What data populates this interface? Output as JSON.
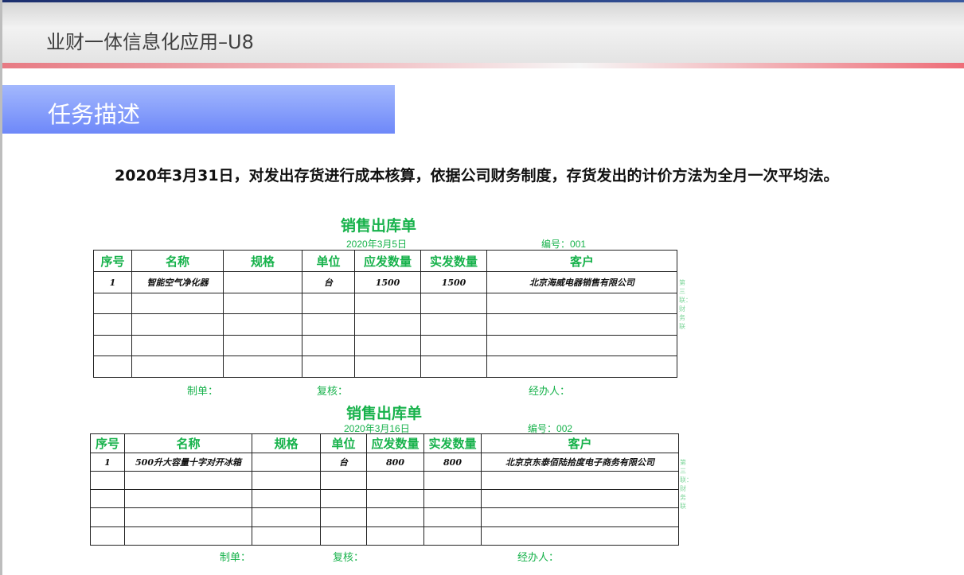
{
  "header": {
    "title": "业财一体信息化应用–U8"
  },
  "section": {
    "title": "任务描述"
  },
  "task": "2020年3月31日，对发出存货进行成本核算，依据公司财务制度，存货发出的计价方法为全月一次平均法。",
  "colors": {
    "green": "#17b24b",
    "section": "#7f97fa"
  },
  "forms": [
    {
      "title": "销售出库单",
      "date": "2020年3月5日",
      "number_label": "编号：",
      "number": "001",
      "columns": [
        "序号",
        "名称",
        "规格",
        "单位",
        "应发数量",
        "实发数量",
        "客户"
      ],
      "rows": [
        [
          "1",
          "智能空气净化器",
          "",
          "台",
          "1500",
          "1500",
          "北京海威电器销售有限公司"
        ],
        [
          "",
          "",
          "",
          "",
          "",
          "",
          ""
        ],
        [
          "",
          "",
          "",
          "",
          "",
          "",
          ""
        ],
        [
          "",
          "",
          "",
          "",
          "",
          "",
          ""
        ],
        [
          "",
          "",
          "",
          "",
          "",
          "",
          ""
        ]
      ],
      "side_note": "第三联：财务联",
      "sign": [
        "制单：",
        "复核：",
        "经办人："
      ]
    },
    {
      "title": "销售出库单",
      "date": "2020年3月16日",
      "number_label": "编号：",
      "number": "002",
      "columns": [
        "序号",
        "名称",
        "规格",
        "单位",
        "应发数量",
        "实发数量",
        "客户"
      ],
      "rows": [
        [
          "1",
          "500升大容量十字对开冰箱",
          "",
          "台",
          "800",
          "800",
          "北京京东泰佰陆拾度电子商务有限公司"
        ],
        [
          "",
          "",
          "",
          "",
          "",
          "",
          ""
        ],
        [
          "",
          "",
          "",
          "",
          "",
          "",
          ""
        ],
        [
          "",
          "",
          "",
          "",
          "",
          "",
          ""
        ],
        [
          "",
          "",
          "",
          "",
          "",
          "",
          ""
        ]
      ],
      "side_note": "第三联：财务联",
      "sign": [
        "制单：",
        "复核：",
        "经办人："
      ]
    }
  ]
}
